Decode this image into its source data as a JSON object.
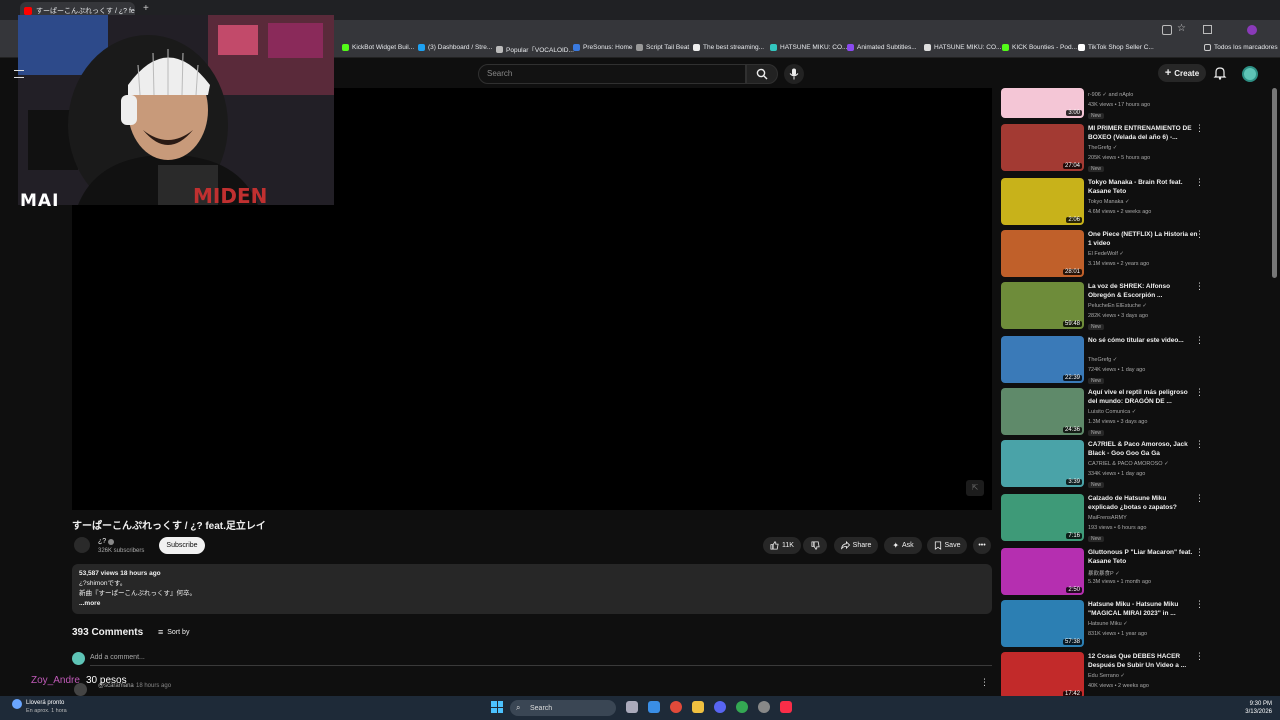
{
  "browser": {
    "tab_title": "すーぱーこんぷれっくす / ¿? feat.足立",
    "bookmarks": [
      {
        "label": "KickBot Widget Buil..."
      },
      {
        "label": "(3) Dashboard / Stre..."
      },
      {
        "label": "Popular「VOCALOID..."
      },
      {
        "label": "PreSonus: Home"
      },
      {
        "label": "Script Tail Beat"
      },
      {
        "label": "The best streaming..."
      },
      {
        "label": "HATSUNE MIKU: CO..."
      },
      {
        "label": "Animated Subtitles..."
      },
      {
        "label": "HATSUNE MIKU: CO..."
      },
      {
        "label": "KICK Bounties - Pod..."
      },
      {
        "label": "TikTok Shop Seller C..."
      },
      {
        "label": "Todos los marcadores"
      }
    ]
  },
  "header": {
    "search_placeholder": "Search",
    "create_label": "Create"
  },
  "overlay": {
    "webcam_label": "MAI"
  },
  "video": {
    "title": "すーぱーこんぷれっくす / ¿? feat.足立レイ",
    "channel_name": "¿?",
    "subscribers": "326K subscribers",
    "subscribe_label": "Subscribe",
    "likes": "11K",
    "share_label": "Share",
    "ask_label": "Ask",
    "save_label": "Save"
  },
  "description": {
    "meta": "53,587 views  18 hours ago",
    "line1": "¿?shimonです。",
    "line2": "新曲『すーぱーこんぷれっくす』何卒。",
    "more": "...more"
  },
  "comments": {
    "count": "393 Comments",
    "sort_label": "Sort by",
    "add_placeholder": "Add a comment...",
    "first_user": "@scaramana",
    "first_time": "18 hours ago"
  },
  "chat_overlay": {
    "user": "Zoy_Andre",
    "message": "30 pesos"
  },
  "recommendations": [
    {
      "title": "",
      "channel": "r-906 ✓ and nAplo",
      "views": "43K views • 17 hours ago",
      "badge": "New",
      "duration": "3:00",
      "color": "#f4c6d6"
    },
    {
      "title": "MI PRIMER ENTRENAMIENTO DE BOXEO (Velada del año 6) -...",
      "channel": "TheGrefg ✓",
      "views": "205K views • 5 hours ago",
      "badge": "New",
      "duration": "27:04",
      "color": "#a33a33"
    },
    {
      "title": "Tokyo Manaka - Brain Rot feat. Kasane Teto",
      "channel": "Tokyo Manaka ✓",
      "views": "4.6M views • 2 weeks ago",
      "badge": "",
      "duration": "2:06",
      "color": "#c8b21a"
    },
    {
      "title": "One Piece (NETFLIX)  La Historia en 1 video",
      "channel": "El FedeWolf ✓",
      "views": "3.1M views • 2 years ago",
      "badge": "",
      "duration": "28:01",
      "color": "#c0602a"
    },
    {
      "title": "La voz de SHREK: Alfonso Obregón & Escorpión ...",
      "channel": "PelucheEn ElEstuche ✓",
      "views": "282K views • 3 days ago",
      "badge": "New",
      "duration": "59:48",
      "color": "#6e8c3a"
    },
    {
      "title": "No sé cómo titular este video...",
      "channel": "TheGrefg ✓",
      "views": "724K views • 1 day ago",
      "badge": "New",
      "duration": "22:39",
      "color": "#3a7ab8"
    },
    {
      "title": "Aquí vive el reptil más peligroso del mundo: DRAGÓN DE ...",
      "channel": "Luisito Comunica ✓",
      "views": "1.3M views • 3 days ago",
      "badge": "New",
      "duration": "24:36",
      "color": "#5f8a6a"
    },
    {
      "title": "CA7RIEL & Paco Amoroso, Jack Black - Goo Goo Ga Ga",
      "channel": "CA7RIEL & PACO AMOROSO ✓",
      "views": "334K views • 1 day ago",
      "badge": "New",
      "duration": "3:39",
      "color": "#4aa3a8"
    },
    {
      "title": "Calzado de Hatsune Miku explicado ¿botas o zapatos?",
      "channel": "MaiFrensARMY",
      "views": "193 views • 6 hours ago",
      "badge": "New",
      "duration": "7:16",
      "color": "#3e9a78"
    },
    {
      "title": "Gluttonous P \"Liar Macaron\" feat. Kasane Teto",
      "channel": "暴飲暴食P ✓",
      "views": "5.3M views • 1 month ago",
      "badge": "",
      "duration": "2:50",
      "color": "#b52fb0"
    },
    {
      "title": "Hatsune Miku - Hatsune Miku \"MAGICAL MIRAI 2023\" in ...",
      "channel": "Hatsune Miku ✓",
      "views": "831K views • 1 year ago",
      "badge": "",
      "duration": "57:38",
      "color": "#2c7fb3"
    },
    {
      "title": "12 Cosas Que DEBES HACER Después De Subir Un Video a ...",
      "channel": "Edu Serrano ✓",
      "views": "40K views • 2 weeks ago",
      "badge": "",
      "duration": "17:42",
      "color": "#c22a2a"
    }
  ],
  "taskbar": {
    "weather_line1": "Lloverá pronto",
    "weather_line2": "En aprox. 1 hora",
    "search_label": "Search",
    "time": "9:30 PM",
    "date": "3/13/2026"
  }
}
